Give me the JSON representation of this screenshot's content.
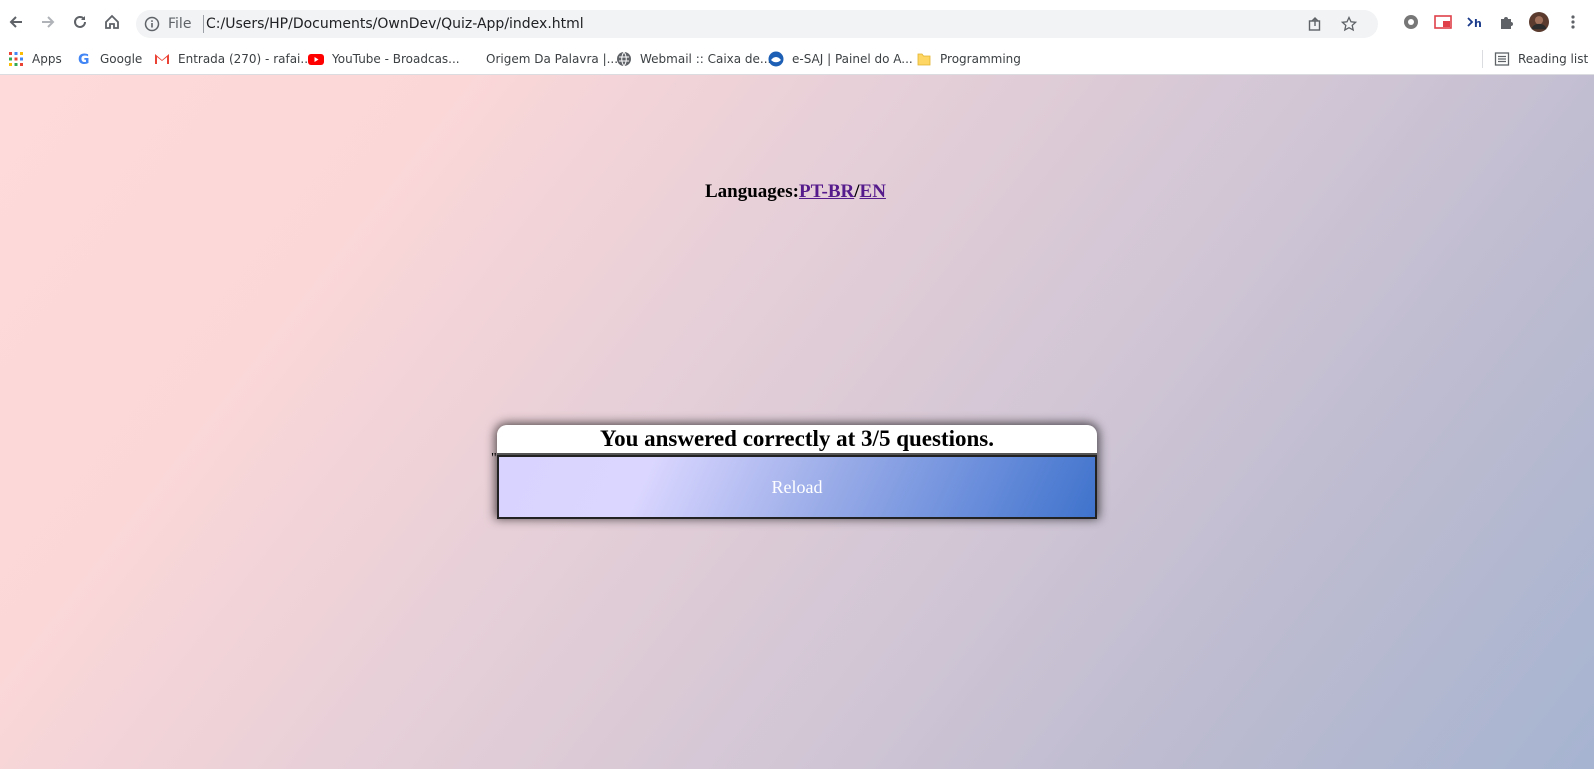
{
  "browser": {
    "omnibox": {
      "scheme_label": "File",
      "url": "C:/Users/HP/Documents/OwnDev/Quiz-App/index.html"
    },
    "bookmarks": [
      {
        "label": "Apps",
        "icon": "apps-grid-icon"
      },
      {
        "label": "Google",
        "icon": "google-icon"
      },
      {
        "label": "Entrada (270) - rafai...",
        "icon": "gmail-icon"
      },
      {
        "label": "YouTube - Broadcas...",
        "icon": "youtube-icon"
      },
      {
        "label": "Origem Da Palavra |...",
        "icon": "none"
      },
      {
        "label": "Webmail :: Caixa de...",
        "icon": "globe-icon"
      },
      {
        "label": "e-SAJ | Painel do A...",
        "icon": "esaj-icon"
      },
      {
        "label": "Programming",
        "icon": "folder-icon"
      }
    ],
    "reading_list_label": "Reading list"
  },
  "page": {
    "languages_label": "Languages:",
    "lang_pt": "PT-BR",
    "lang_sep": "/",
    "lang_en": "EN",
    "quote_mark": "\"",
    "result_text": "You answered correctly at 3/5 questions.",
    "reload_label": "Reload"
  },
  "colors": {
    "link": "#551a8b",
    "button_gradient_start": "#d8d4ff",
    "button_gradient_end": "#3f73cc",
    "page_gradient_start": "#ffdada",
    "page_gradient_end": "#a6b4d1"
  }
}
